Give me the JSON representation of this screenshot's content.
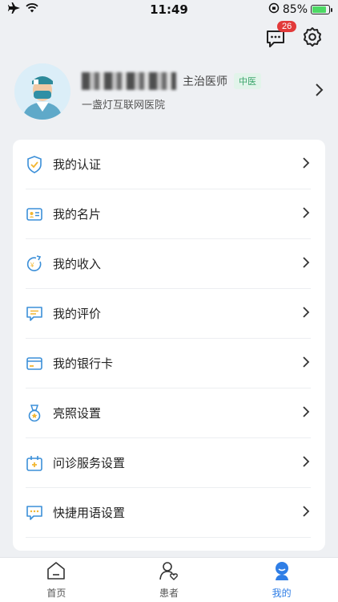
{
  "status_bar": {
    "time": "11:49",
    "battery_percent": "85%",
    "battery_level": 0.85
  },
  "header": {
    "message_badge": "26",
    "icons": [
      "message-icon",
      "gear-icon"
    ]
  },
  "profile": {
    "name": "",
    "title": "主治医师",
    "tag": "中医",
    "hospital": "一盏灯互联网医院"
  },
  "menu": [
    {
      "label": "我的认证",
      "icon": "shield-check-icon"
    },
    {
      "label": "我的名片",
      "icon": "id-card-icon"
    },
    {
      "label": "我的收入",
      "icon": "income-icon"
    },
    {
      "label": "我的评价",
      "icon": "comment-icon"
    },
    {
      "label": "我的银行卡",
      "icon": "bank-card-icon"
    },
    {
      "label": "亮照设置",
      "icon": "medal-icon"
    },
    {
      "label": "问诊服务设置",
      "icon": "service-calendar-icon"
    },
    {
      "label": "快捷用语设置",
      "icon": "quick-phrase-icon"
    }
  ],
  "tabs": [
    {
      "label": "首页",
      "icon": "home-icon",
      "active": false
    },
    {
      "label": "患者",
      "icon": "patient-icon",
      "active": false
    },
    {
      "label": "我的",
      "icon": "profile-icon",
      "active": true
    }
  ],
  "colors": {
    "accent": "#2f7ee6",
    "icon_blue": "#3b8fd8",
    "icon_yellow": "#f2b632",
    "badge": "#e23a3a",
    "tag_green": "#3aa56b"
  }
}
